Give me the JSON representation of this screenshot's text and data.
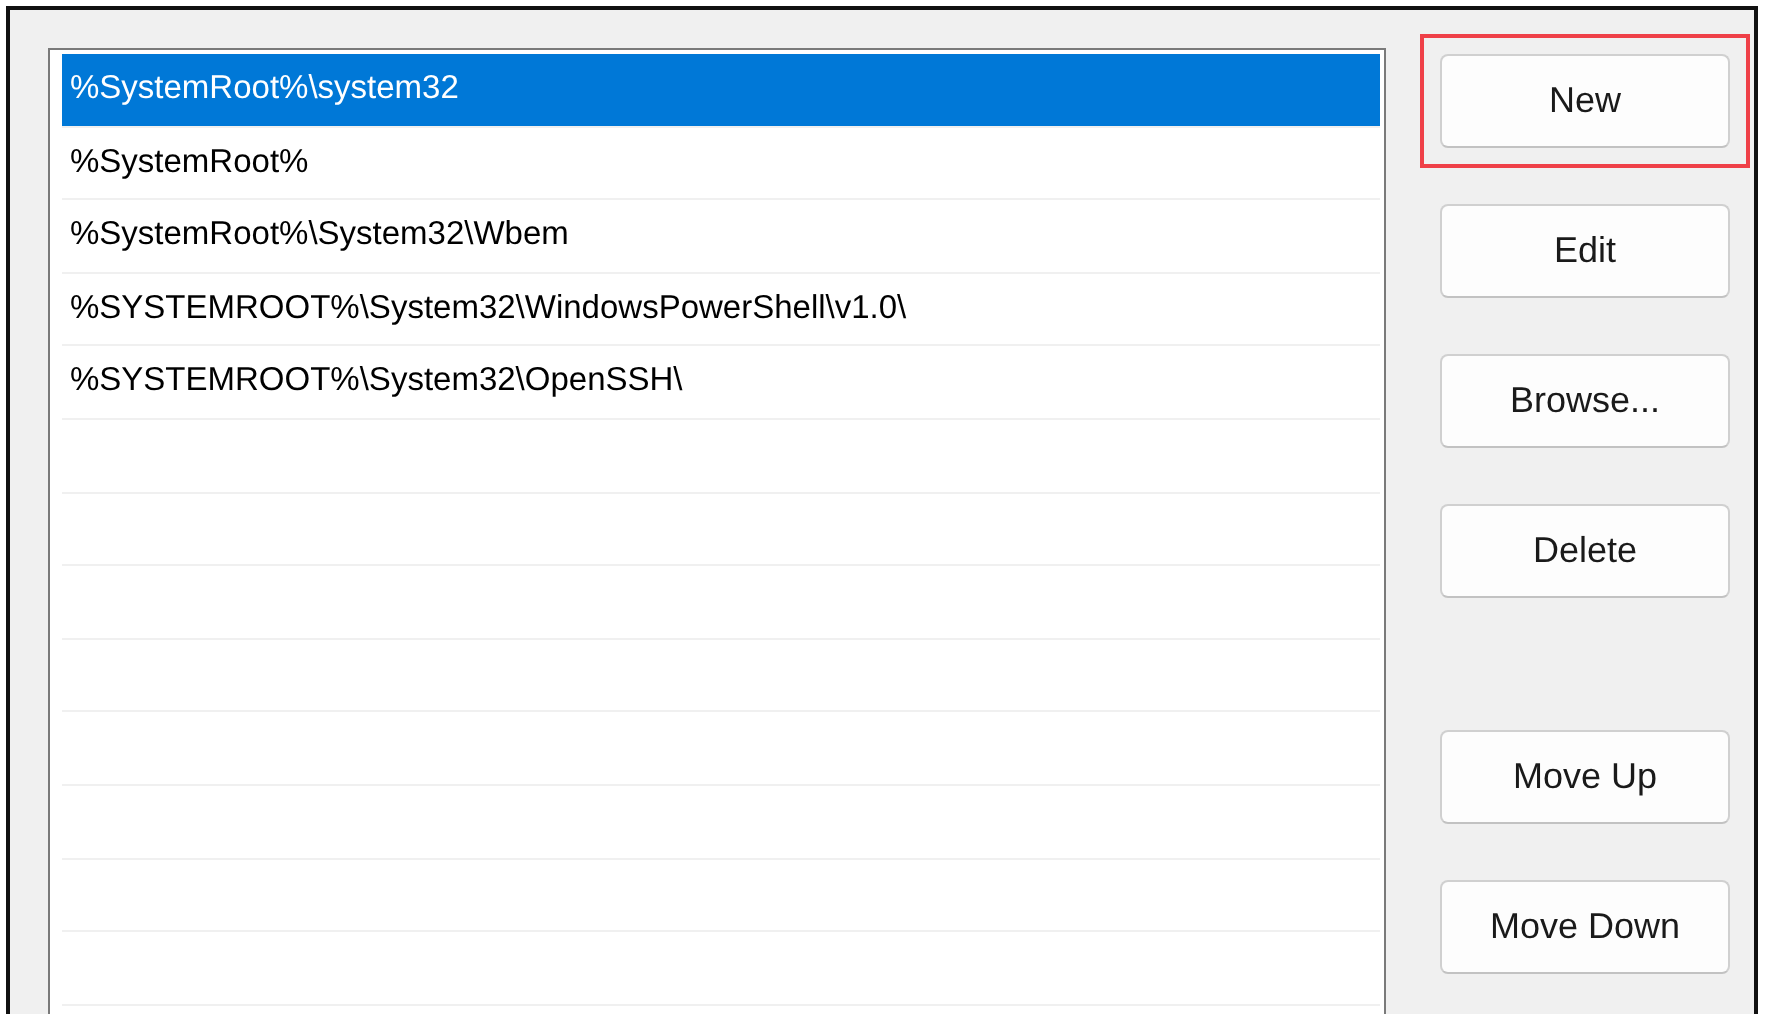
{
  "path_list": [
    {
      "text": "%SystemRoot%\\system32",
      "selected": true
    },
    {
      "text": "%SystemRoot%",
      "selected": false
    },
    {
      "text": "%SystemRoot%\\System32\\Wbem",
      "selected": false
    },
    {
      "text": "%SYSTEMROOT%\\System32\\WindowsPowerShell\\v1.0\\",
      "selected": false
    },
    {
      "text": "%SYSTEMROOT%\\System32\\OpenSSH\\",
      "selected": false
    }
  ],
  "buttons": [
    {
      "label": "New",
      "highlighted": true
    },
    {
      "label": "Edit",
      "highlighted": false
    },
    {
      "label": "Browse...",
      "highlighted": false
    },
    {
      "label": "Delete",
      "highlighted": false
    }
  ],
  "move_buttons": [
    {
      "label": "Move Up",
      "highlighted": false
    },
    {
      "label": "Move Down",
      "highlighted": false
    }
  ]
}
